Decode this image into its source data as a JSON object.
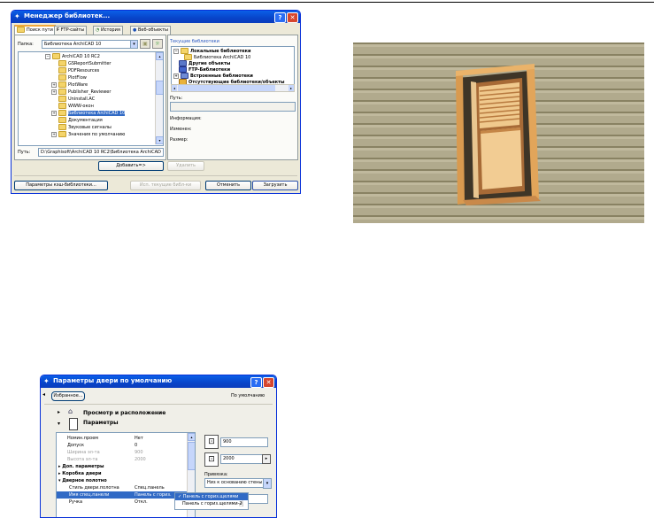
{
  "library_manager": {
    "title": "Менеджер библиотек...",
    "tabs": [
      "Поиск пути",
      "FTP-сайты",
      "История",
      "Веб-объекты"
    ],
    "folder_label": "Папка:",
    "folder_value": "Библиотека ArchiCAD 10",
    "tree_items": [
      {
        "label": "ArchiCAD 10 RC2",
        "expander": "−"
      },
      {
        "label": "GSReportSubmitter",
        "expander": ""
      },
      {
        "label": "PDFResources",
        "expander": ""
      },
      {
        "label": "PlotFlow",
        "expander": ""
      },
      {
        "label": "PlotWare",
        "expander": "+"
      },
      {
        "label": "Publisher_Reviewer",
        "expander": "+"
      },
      {
        "label": "Uninstall.AC",
        "expander": ""
      },
      {
        "label": "WWW-окон",
        "expander": ""
      },
      {
        "label": "Библиотека ArchiCAD 10",
        "expander": "+"
      },
      {
        "label": "Документация",
        "expander": ""
      },
      {
        "label": "Звуковые сигналы",
        "expander": ""
      },
      {
        "label": "Значения по умолчанию",
        "expander": "+"
      }
    ],
    "path_label": "Путь:",
    "path_value": "D:\\Graphisoft\\ArchiCAD 10 RC2\\Библиотека ArchiCAD",
    "add_button": "Добавить=>",
    "delete_button": "Удалить",
    "current_libs_label": "Текущие библиотеки",
    "current_libs": [
      {
        "label": "Локальные библиотеки",
        "expander": "−",
        "bold": true
      },
      {
        "label": "Библиотека ArchiCAD 10",
        "expander": "",
        "bold": false
      },
      {
        "label": "Другие объекты",
        "expander": "",
        "bold": true
      },
      {
        "label": "FTP-Библиотеки",
        "expander": "",
        "bold": true
      },
      {
        "label": "Встроенные библиотеки",
        "expander": "+",
        "bold": true
      },
      {
        "label": "Отсутствующие библиотеки/объекты",
        "expander": "",
        "bold": true
      }
    ],
    "right_path_label": "Путь:",
    "info_label": "Информация:",
    "changed_label": "Изменен:",
    "size_label": "Размер:",
    "bottom_buttons": {
      "params": "Параметры кэш-библиотеки...",
      "use_current": "Исп. текущие библ-ки",
      "cancel": "Отменить",
      "load": "Загрузить"
    }
  },
  "door_params": {
    "title": "Параметры двери по умолчанию",
    "favorites_button": "Избранное...",
    "default_label": "По умолчанию",
    "section_preview": "Просмотр и расположение",
    "section_params": "Параметры",
    "param_rows": [
      {
        "name": "Номин.проем",
        "value": "Нет",
        "indent": 0,
        "style": "normal"
      },
      {
        "name": "Допуск",
        "value": "0",
        "indent": 0,
        "style": "normal"
      },
      {
        "name": "Ширина эл-та",
        "value": "900",
        "indent": 0,
        "style": "dim"
      },
      {
        "name": "Высота эл-та",
        "value": "2000",
        "indent": 0,
        "style": "dim"
      },
      {
        "name": "Доп. параметры",
        "value": "",
        "indent": -1,
        "style": "bold"
      },
      {
        "name": "Коробка двери",
        "value": "",
        "indent": -1,
        "style": "bold"
      },
      {
        "name": "Дверное полотно",
        "value": "",
        "indent": -1,
        "style": "bold"
      },
      {
        "name": "Стиль двери.полотна",
        "value": "Спец.панель",
        "indent": 1,
        "style": "normal"
      },
      {
        "name": "Имя спец.панели",
        "value": "Панель с гориз.",
        "indent": 1,
        "style": "selected"
      },
      {
        "name": "Ручка",
        "value": "Откл.",
        "indent": 1,
        "style": "normal"
      }
    ],
    "width_value": "900",
    "height_value": "2000",
    "anchor_label": "Привязка:",
    "anchor_value": "Низ к основанию стены",
    "menu_items": [
      "Панель с гориз.щелями",
      "Панель с гориз.щелями-2"
    ]
  }
}
